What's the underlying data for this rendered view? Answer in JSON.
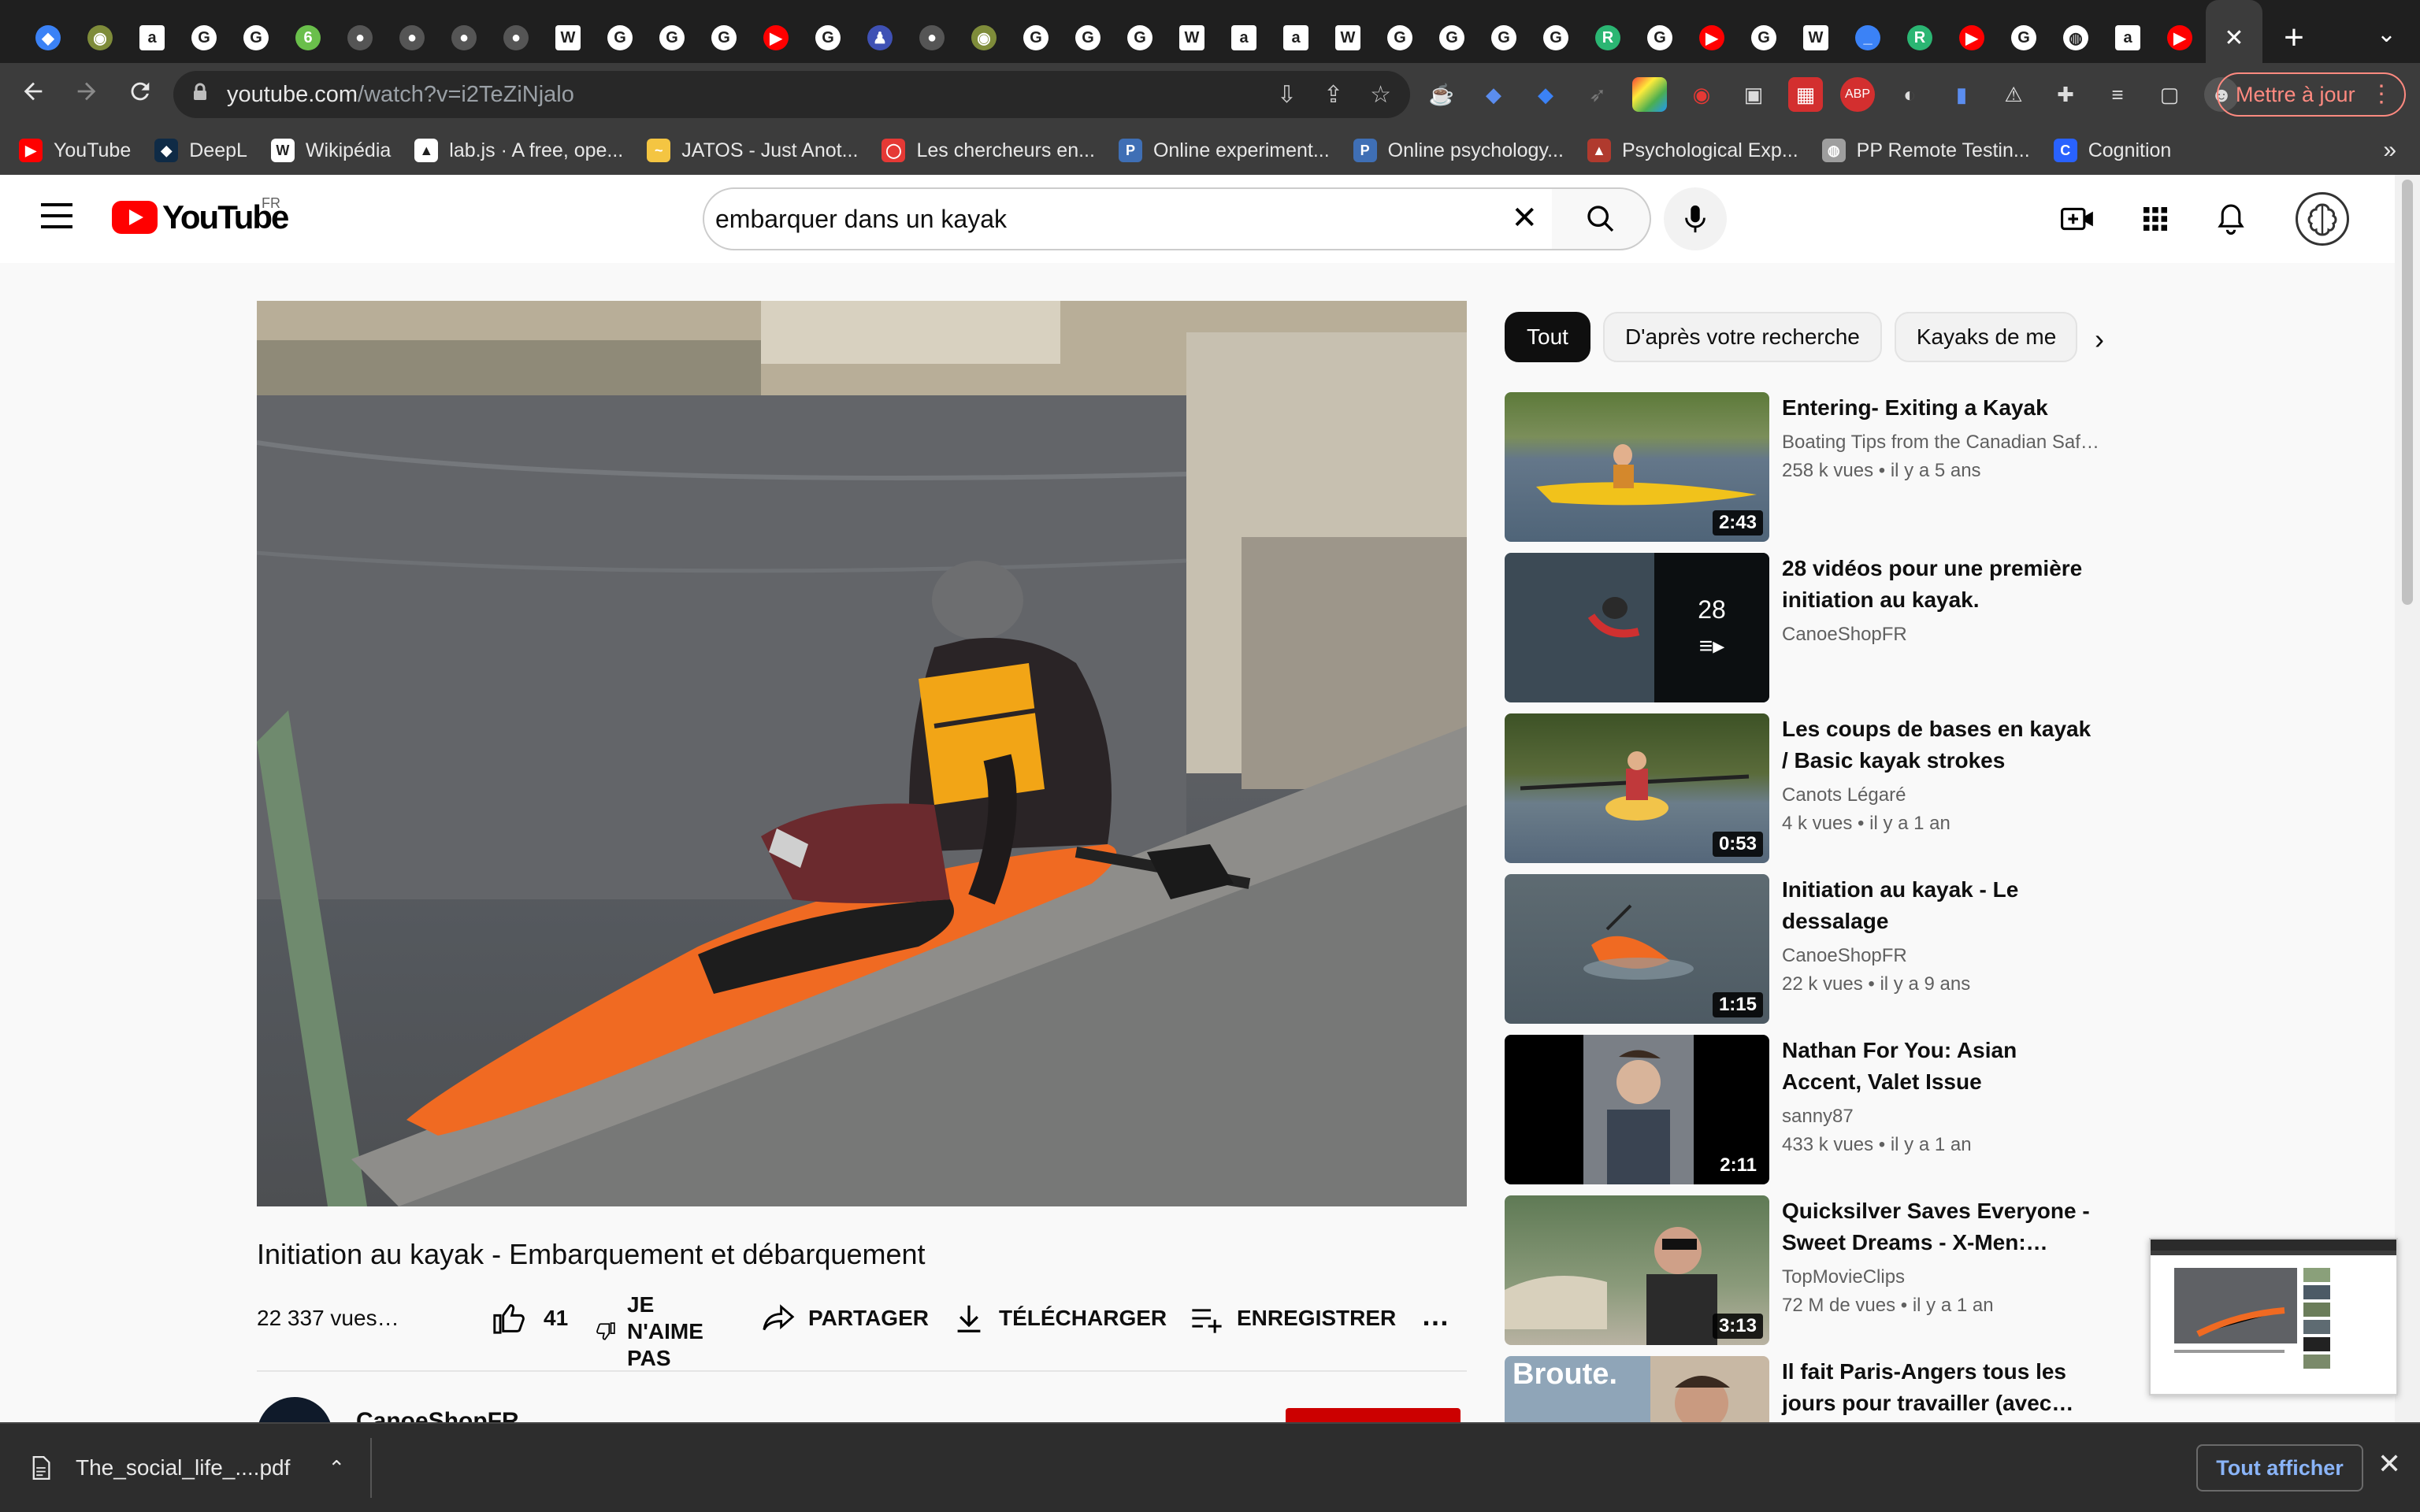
{
  "browser": {
    "active_tab_close": "✕",
    "new_tab": "+",
    "tab_menu": "⌄",
    "tabs": [
      {
        "icon": "diamond-icon",
        "color": "#3b82f6",
        "glyph": "◆"
      },
      {
        "icon": "cat-icon",
        "color": "#7f8c3a",
        "glyph": "◉"
      },
      {
        "icon": "amazon-icon",
        "color": "#ffffff",
        "glyph": "a"
      },
      {
        "icon": "google-icon",
        "color": "#ffffff",
        "glyph": "G"
      },
      {
        "icon": "google-icon",
        "color": "#ffffff",
        "glyph": "G"
      },
      {
        "icon": "leaf-icon",
        "color": "#6abf4b",
        "glyph": "6"
      },
      {
        "icon": "github-icon",
        "color": "#555555",
        "glyph": "●"
      },
      {
        "icon": "github-icon",
        "color": "#555555",
        "glyph": "●"
      },
      {
        "icon": "github-icon",
        "color": "#555555",
        "glyph": "●"
      },
      {
        "icon": "github-icon",
        "color": "#555555",
        "glyph": "●"
      },
      {
        "icon": "wikipedia-icon",
        "color": "#ffffff",
        "glyph": "W"
      },
      {
        "icon": "google-icon",
        "color": "#ffffff",
        "glyph": "G"
      },
      {
        "icon": "google-icon",
        "color": "#ffffff",
        "glyph": "G"
      },
      {
        "icon": "google-icon",
        "color": "#ffffff",
        "glyph": "G"
      },
      {
        "icon": "youtube-icon",
        "color": "#ff0000",
        "glyph": "▶"
      },
      {
        "icon": "google-icon",
        "color": "#ffffff",
        "glyph": "G"
      },
      {
        "icon": "person-icon",
        "color": "#3f51b5",
        "glyph": "♟"
      },
      {
        "icon": "github-icon",
        "color": "#555555",
        "glyph": "●"
      },
      {
        "icon": "cat-icon",
        "color": "#7f8c3a",
        "glyph": "◉"
      },
      {
        "icon": "google-icon",
        "color": "#ffffff",
        "glyph": "G"
      },
      {
        "icon": "google-icon",
        "color": "#ffffff",
        "glyph": "G"
      },
      {
        "icon": "google-icon",
        "color": "#ffffff",
        "glyph": "G"
      },
      {
        "icon": "wikipedia-icon",
        "color": "#ffffff",
        "glyph": "W"
      },
      {
        "icon": "amazon-icon",
        "color": "#ffffff",
        "glyph": "a"
      },
      {
        "icon": "amazon-icon",
        "color": "#ffffff",
        "glyph": "a"
      },
      {
        "icon": "wikipedia-icon",
        "color": "#ffffff",
        "glyph": "W"
      },
      {
        "icon": "google-icon",
        "color": "#ffffff",
        "glyph": "G"
      },
      {
        "icon": "google-icon",
        "color": "#ffffff",
        "glyph": "G"
      },
      {
        "icon": "google-icon",
        "color": "#ffffff",
        "glyph": "G"
      },
      {
        "icon": "google-icon",
        "color": "#ffffff",
        "glyph": "G"
      },
      {
        "icon": "r-icon",
        "color": "#2bb673",
        "glyph": "R"
      },
      {
        "icon": "google-icon",
        "color": "#ffffff",
        "glyph": "G"
      },
      {
        "icon": "youtube-icon",
        "color": "#ff0000",
        "glyph": "▶"
      },
      {
        "icon": "google-icon",
        "color": "#ffffff",
        "glyph": "G"
      },
      {
        "icon": "wikipedia-icon",
        "color": "#ffffff",
        "glyph": "W"
      },
      {
        "icon": "line-icon",
        "color": "#3b82f6",
        "glyph": "_"
      },
      {
        "icon": "r-icon",
        "color": "#2bb673",
        "glyph": "R"
      },
      {
        "icon": "youtube-icon",
        "color": "#ff0000",
        "glyph": "▶"
      },
      {
        "icon": "google-icon",
        "color": "#ffffff",
        "glyph": "G"
      },
      {
        "icon": "globe-icon",
        "color": "#ffffff",
        "glyph": "◍"
      },
      {
        "icon": "amazon-icon",
        "color": "#ffffff",
        "glyph": "a"
      },
      {
        "icon": "youtube-icon",
        "color": "#ff0000",
        "glyph": "▶"
      }
    ],
    "url_host": "youtube.com",
    "url_path": "/watch?v=i2TeZiNjalo",
    "update_label": "Mettre à jour",
    "bookmarks": [
      {
        "label": "YouTube",
        "icon": "youtube-icon",
        "color": "#ff0000",
        "glyph": "▶"
      },
      {
        "label": "DeepL",
        "icon": "deepl-icon",
        "color": "#0f2b46",
        "glyph": "◆"
      },
      {
        "label": "Wikipédia",
        "icon": "wikipedia-icon",
        "color": "#ffffff",
        "glyph": "W"
      },
      {
        "label": "lab.js · A free, ope...",
        "icon": "flask-icon",
        "color": "#ffffff",
        "glyph": "▲"
      },
      {
        "label": "JATOS - Just Anot...",
        "icon": "jatos-icon",
        "color": "#f4c542",
        "glyph": "~"
      },
      {
        "label": "Les chercheurs en...",
        "icon": "chat-icon",
        "color": "#e53935",
        "glyph": "◯"
      },
      {
        "label": "Online experiment...",
        "icon": "p-icon",
        "color": "#3f6fb5",
        "glyph": "P"
      },
      {
        "label": "Online psychology...",
        "icon": "p-icon",
        "color": "#3f6fb5",
        "glyph": "P"
      },
      {
        "label": "Psychological Exp...",
        "icon": "pe-icon",
        "color": "#b03a2e",
        "glyph": "▲"
      },
      {
        "label": "PP Remote Testin...",
        "icon": "globe-icon",
        "color": "#9e9e9e",
        "glyph": "◍"
      },
      {
        "label": "Cognition",
        "icon": "cognition-icon",
        "color": "#2962ff",
        "glyph": "C"
      }
    ],
    "bookmarks_more": "»"
  },
  "youtube": {
    "logo_text": "YouTube",
    "country": "FR",
    "search_value": "embarquer dans un kayak",
    "video": {
      "title": "Initiation au kayak - Embarquement et débarquement",
      "views": "22 337 vues…",
      "likes": "41",
      "dislike_label": "JE N'AIME PAS",
      "share_label": "PARTAGER",
      "download_label": "TÉLÉCHARGER",
      "save_label": "ENREGISTRER",
      "more_label": "…",
      "channel": "CanoeShopFR"
    },
    "chips": [
      "Tout",
      "D'après votre recherche",
      "Kayaks de me"
    ],
    "recommendations": [
      {
        "title": "Entering- Exiting a Kayak",
        "channel": "Boating Tips from the Canadian Saf…",
        "meta": "258 k vues • il y a 5 ans",
        "duration": "2:43"
      },
      {
        "title": "28 vidéos pour une première initiation au kayak.",
        "channel": "CanoeShopFR",
        "meta": "",
        "playlist_count": "28"
      },
      {
        "title": "Les coups de bases en kayak / Basic kayak strokes",
        "channel": "Canots Légaré",
        "meta": "4 k vues • il y a 1 an",
        "duration": "0:53"
      },
      {
        "title": "Initiation au kayak - Le dessalage",
        "channel": "CanoeShopFR",
        "meta": "22 k vues • il y a 9 ans",
        "duration": "1:15"
      },
      {
        "title": "Nathan For You: Asian Accent, Valet Issue",
        "channel": "sanny87",
        "meta": "433 k vues • il y a 1 an",
        "duration": "2:11"
      },
      {
        "title": "Quicksilver Saves Everyone - Sweet Dreams - X-Men:…",
        "channel": "TopMovieClips",
        "meta": "72 M de vues • il y a 1 an",
        "duration": "3:13"
      },
      {
        "title": "Il fait Paris-Angers tous les jours pour travailler (avec…",
        "channel": "",
        "meta": "",
        "thumb_text": "Broute."
      }
    ]
  },
  "downloads": {
    "file_name": "The_social_life_....pdf",
    "show_all_label": "Tout afficher"
  },
  "colors": {
    "yt_red": "#ff0000",
    "chrome_dark": "#1f1f1f",
    "chrome_toolbar": "#3c3c3c",
    "link_blue": "#8ab4f8"
  }
}
